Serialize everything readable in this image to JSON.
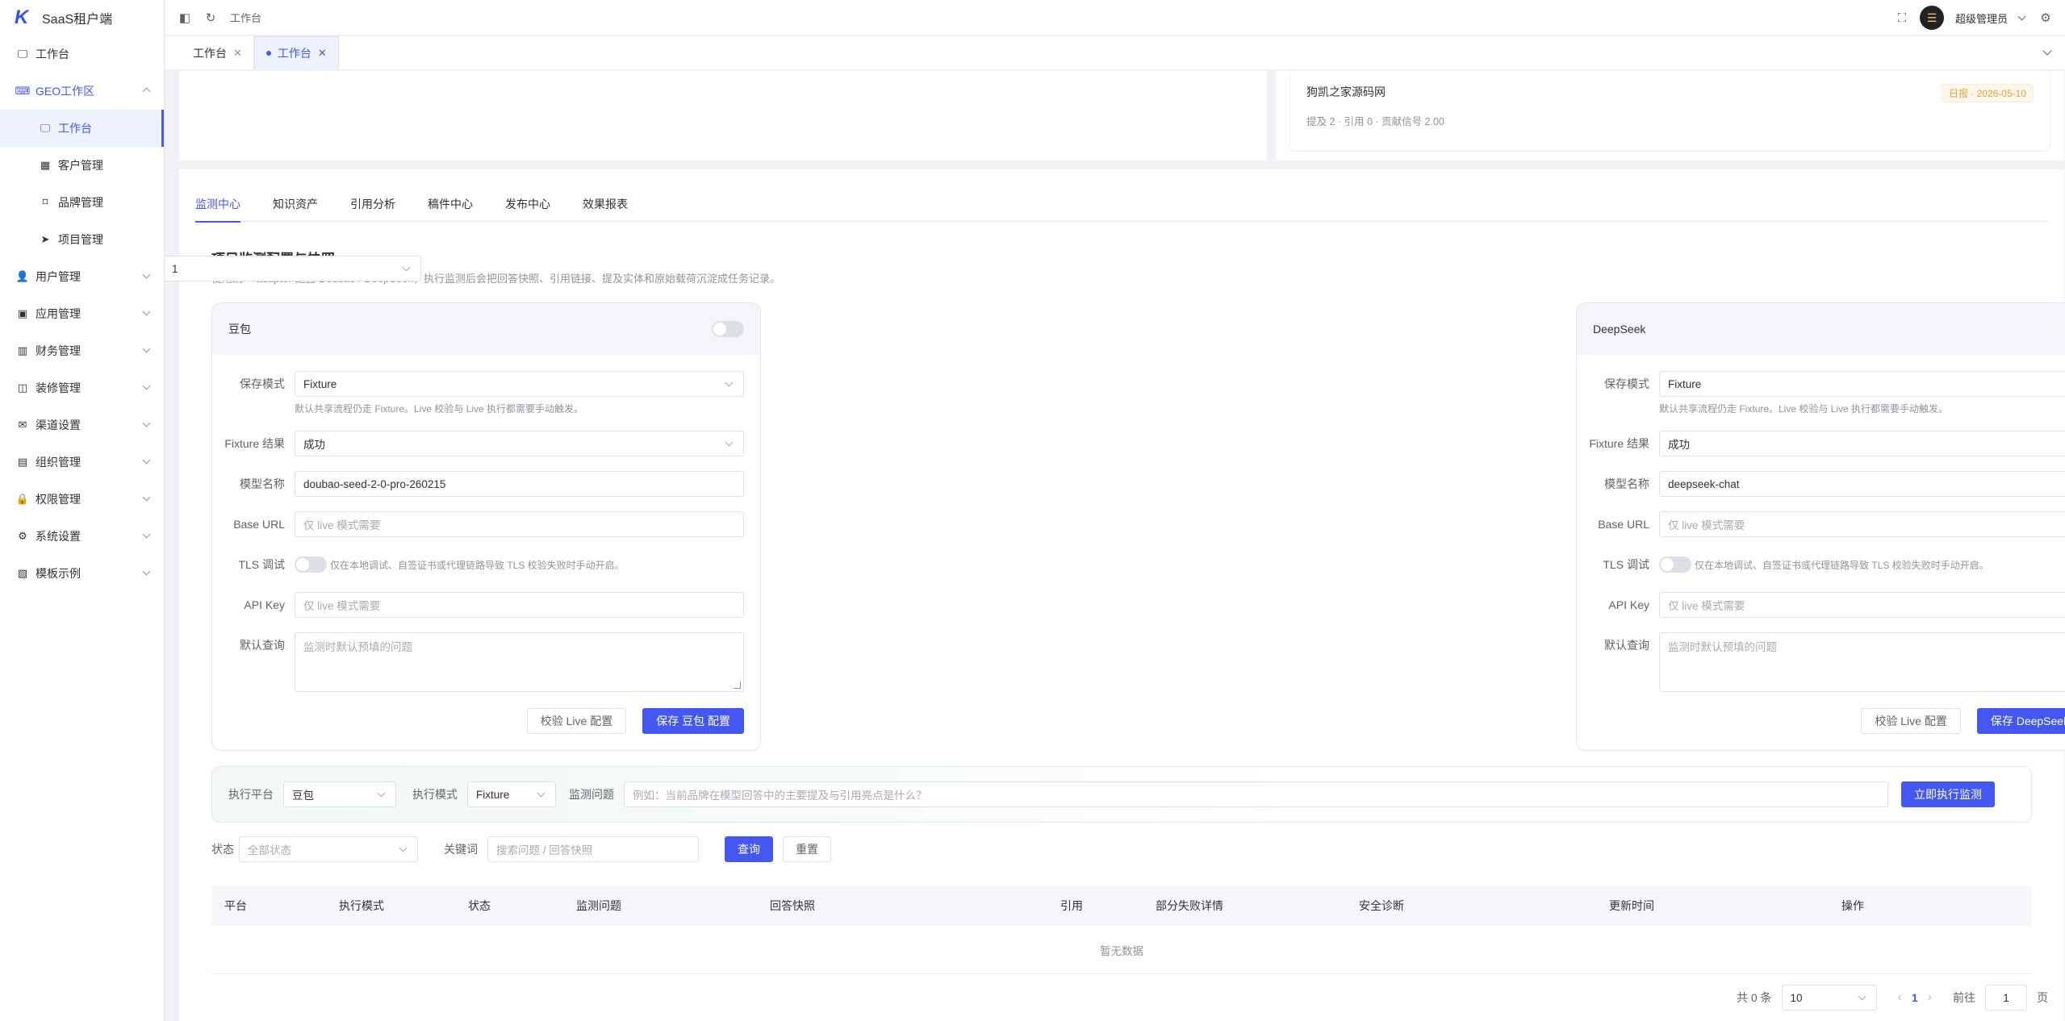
{
  "app": {
    "title": "SaaS租户端",
    "logo": "K"
  },
  "sidebar": {
    "items": [
      {
        "label": "工作台",
        "icon": "monitor-icon",
        "glyph": "🖵",
        "type": "top"
      },
      {
        "label": "GEO工作区",
        "icon": "chat-icon",
        "glyph": "⌨",
        "type": "group-open"
      },
      {
        "label": "工作台",
        "icon": "monitor-icon",
        "glyph": "🖵",
        "type": "sub-active"
      },
      {
        "label": "客户管理",
        "icon": "building-icon",
        "glyph": "▦",
        "type": "sub"
      },
      {
        "label": "品牌管理",
        "icon": "bookmark-icon",
        "glyph": "⌑",
        "type": "sub"
      },
      {
        "label": "项目管理",
        "icon": "send-icon",
        "glyph": "➤",
        "type": "sub"
      },
      {
        "label": "用户管理",
        "icon": "user-icon",
        "glyph": "👤",
        "type": "group"
      },
      {
        "label": "应用管理",
        "icon": "app-icon",
        "glyph": "▣",
        "type": "group"
      },
      {
        "label": "财务管理",
        "icon": "chart-icon",
        "glyph": "▥",
        "type": "group"
      },
      {
        "label": "装修管理",
        "icon": "decor-icon",
        "glyph": "◫",
        "type": "group"
      },
      {
        "label": "渠道设置",
        "icon": "mail-icon",
        "glyph": "✉",
        "type": "group"
      },
      {
        "label": "组织管理",
        "icon": "org-icon",
        "glyph": "▤",
        "type": "group"
      },
      {
        "label": "权限管理",
        "icon": "lock-icon",
        "glyph": "🔒",
        "type": "group"
      },
      {
        "label": "系统设置",
        "icon": "gear-icon",
        "glyph": "⚙",
        "type": "group"
      },
      {
        "label": "模板示例",
        "icon": "template-icon",
        "glyph": "▧",
        "type": "group"
      }
    ]
  },
  "header": {
    "breadcrumb": "工作台",
    "user": "超级管理员",
    "avatar_glyph": "☰"
  },
  "page_tabs": [
    {
      "label": "工作台"
    },
    {
      "label": "工作台"
    }
  ],
  "rank_card": {
    "title": "狗凯之家源码网",
    "meta": "提及 2 · 引用 0 · 贡献信号 2.00",
    "badge": "日报 · 2026-05-10"
  },
  "sub_tabs": [
    "监测中心",
    "知识资产",
    "引用分析",
    "稿件中心",
    "发布中心",
    "效果报表"
  ],
  "section": {
    "title": "项目监测配置与快照",
    "desc": "使用统一 adapter 配置 Doubao / DeepSeek，执行监测后会把回答快照、引用链接、提及实体和原始载荷沉淀成任务记录。",
    "project_value": "1"
  },
  "labels": {
    "save_mode": "保存模式",
    "fixture_result": "Fixture 结果",
    "model_name": "模型名称",
    "base_url": "Base URL",
    "tls": "TLS 调试",
    "api_key": "API Key",
    "default_query": "默认查询"
  },
  "providers": [
    {
      "name": "豆包",
      "save_mode": "Fixture",
      "save_hint": "默认共享流程仍走 Fixture。Live 校验与 Live 执行都需要手动触发。",
      "fixture_result": "成功",
      "model_name": "doubao-seed-2-0-pro-260215",
      "base_url_ph": "仅 live 模式需要",
      "tls_hint": "仅在本地调试、自签证书或代理链路导致 TLS 校验失败时手动开启。",
      "api_key_ph": "仅 live 模式需要",
      "query_ph": "监测时默认预填的问题",
      "btn_validate": "校验 Live 配置",
      "btn_save": "保存 豆包 配置"
    },
    {
      "name": "DeepSeek",
      "save_mode": "Fixture",
      "save_hint": "默认共享流程仍走 Fixture。Live 校验与 Live 执行都需要手动触发。",
      "fixture_result": "成功",
      "model_name": "deepseek-chat",
      "base_url_ph": "仅 live 模式需要",
      "tls_hint": "仅在本地调试、自签证书或代理链路导致 TLS 校验失败时手动开启。",
      "api_key_ph": "仅 live 模式需要",
      "query_ph": "监测时默认预填的问题",
      "btn_validate": "校验 Live 配置",
      "btn_save": "保存 DeepSeek 配置"
    }
  ],
  "exec": {
    "platform_label": "执行平台",
    "platform_value": "豆包",
    "mode_label": "执行模式",
    "mode_value": "Fixture",
    "question_label": "监测问题",
    "question_ph": "例如：当前品牌在模型回答中的主要提及与引用亮点是什么？",
    "run_btn": "立即执行监测"
  },
  "filter": {
    "status_label": "状态",
    "status_ph": "全部状态",
    "keyword_label": "关键词",
    "keyword_ph": "搜索问题 / 回答快照",
    "query_btn": "查询",
    "reset_btn": "重置"
  },
  "table": {
    "columns": [
      "平台",
      "执行模式",
      "状态",
      "监测问题",
      "回答快照",
      "引用",
      "部分失败详情",
      "安全诊断",
      "更新时间",
      "操作"
    ],
    "empty": "暂无数据"
  },
  "pager": {
    "total": "共 0 条",
    "page_size": "10",
    "current": "1",
    "goto_label": "前往",
    "goto_value": "1",
    "page_suffix": "页"
  }
}
